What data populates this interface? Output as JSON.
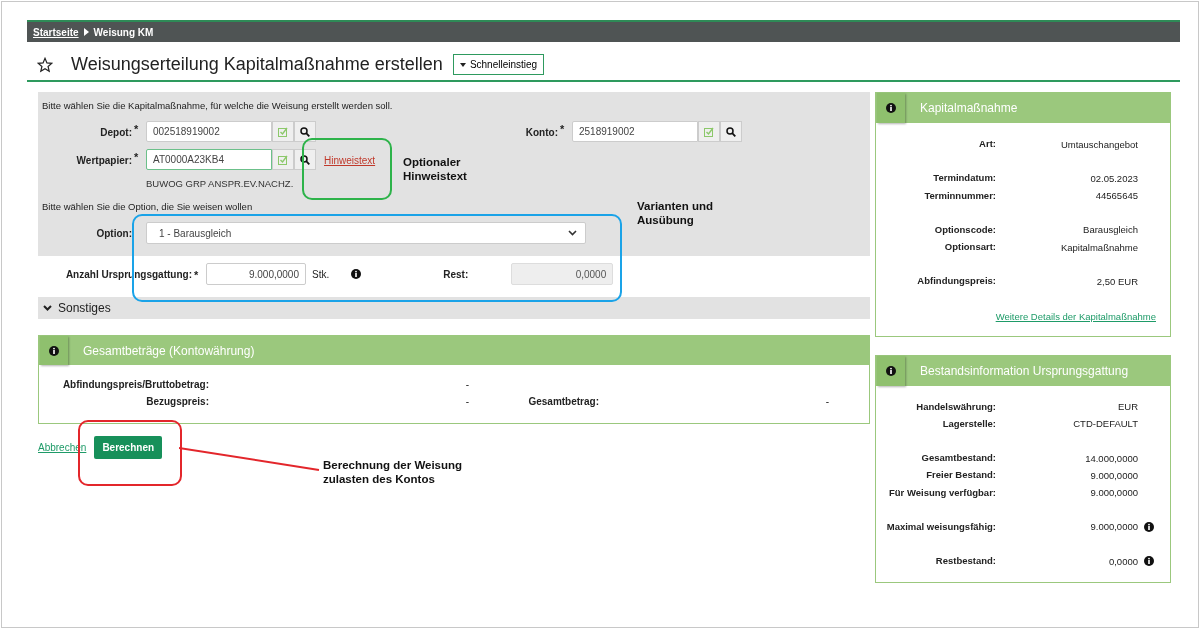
{
  "breadcrumb": [
    {
      "label": "Startseite",
      "kind": "link"
    },
    {
      "label": "Weisung KM",
      "kind": "current"
    }
  ],
  "page_title": "Weisungserteilung Kapitalmaßnahme erstellen",
  "quick_entry": "Schnelleinstieg",
  "form": {
    "intro": "Bitte wählen Sie die Kapitalmaßnahme, für welche die Weisung erstellt werden soll.",
    "depot": {
      "label": "Depot:",
      "required": "*",
      "value": "002518919002",
      "focused": false
    },
    "konto": {
      "label": "Konto:",
      "required": "*",
      "value": "2518919002",
      "focused": false
    },
    "wertpapier": {
      "label": "Wertpapier:",
      "required": "*",
      "value": "AT0000A23KB4",
      "focused": true,
      "description": "BUWOG GRP ANSPR.EV.NACHZ.",
      "hint_link": "Hinweistext"
    },
    "option_intro": "Bitte wählen Sie die Option, die Sie weisen wollen",
    "option": {
      "label": "Option:",
      "value": "1 - Barausgleich"
    },
    "quantity": {
      "label": "Anzahl Ursprungsgattung:",
      "required": "*",
      "value": "9.000,0000",
      "unit": "Stk."
    },
    "rest": {
      "label": "Rest:",
      "value": "0,0000",
      "disabled": true
    }
  },
  "sonstiges": {
    "label": "Sonstiges"
  },
  "totals": {
    "title": "Gesamtbeträge (Kontowährung)",
    "rows": [
      [
        {
          "label": "Abfindungspreis/Bruttobetrag:",
          "value": "-"
        }
      ],
      [
        {
          "label": "Bezugspreis:",
          "value": "-"
        },
        {
          "label": "Gesamtbetrag:",
          "value": "-"
        }
      ]
    ]
  },
  "actions": {
    "cancel": "Abbrechen",
    "calculate": "Berechnen"
  },
  "side_panels": [
    {
      "title": "Kapitalmaßnahme",
      "groups": [
        [
          {
            "label": "Art:",
            "value": "Umtauschangebot",
            "info": false
          }
        ],
        [
          {
            "label": "Termindatum:",
            "value": "02.05.2023",
            "info": false
          },
          {
            "label": "Terminnummer:",
            "value": "44565645",
            "info": false
          }
        ],
        [
          {
            "label": "Optionscode:",
            "value": "Barausgleich",
            "info": false
          },
          {
            "label": "Optionsart:",
            "value": "Kapitalmaßnahme",
            "info": false
          }
        ],
        [
          {
            "label": "Abfindungspreis:",
            "value": "2,50 EUR",
            "info": false
          }
        ]
      ],
      "link": "Weitere Details der Kapitalmaßnahme"
    },
    {
      "title": "Bestandsinformation Ursprungsgattung",
      "groups": [
        [
          {
            "label": "Handelswährung:",
            "value": "EUR",
            "info": false
          },
          {
            "label": "Lagerstelle:",
            "value": "CTD-DEFAULT",
            "info": false
          }
        ],
        [
          {
            "label": "Gesamtbestand:",
            "value": "14.000,0000",
            "info": false
          },
          {
            "label": "Freier Bestand:",
            "value": "9.000,0000",
            "info": false
          },
          {
            "label": "Für Weisung verfügbar:",
            "value": "9.000,0000",
            "info": false
          }
        ],
        [
          {
            "label": "Maximal weisungsfähig:",
            "value": "9.000,0000",
            "info": true
          }
        ],
        [
          {
            "label": "Restbestand:",
            "value": "0,0000",
            "info": true
          }
        ]
      ]
    }
  ],
  "annotations": [
    {
      "kind": "green",
      "text": "Optionaler Hinweistext"
    },
    {
      "kind": "blue",
      "text": "Varianten und Ausübung"
    },
    {
      "kind": "red",
      "text": "Berechnung der Weisung zulasten des Kontos"
    }
  ]
}
